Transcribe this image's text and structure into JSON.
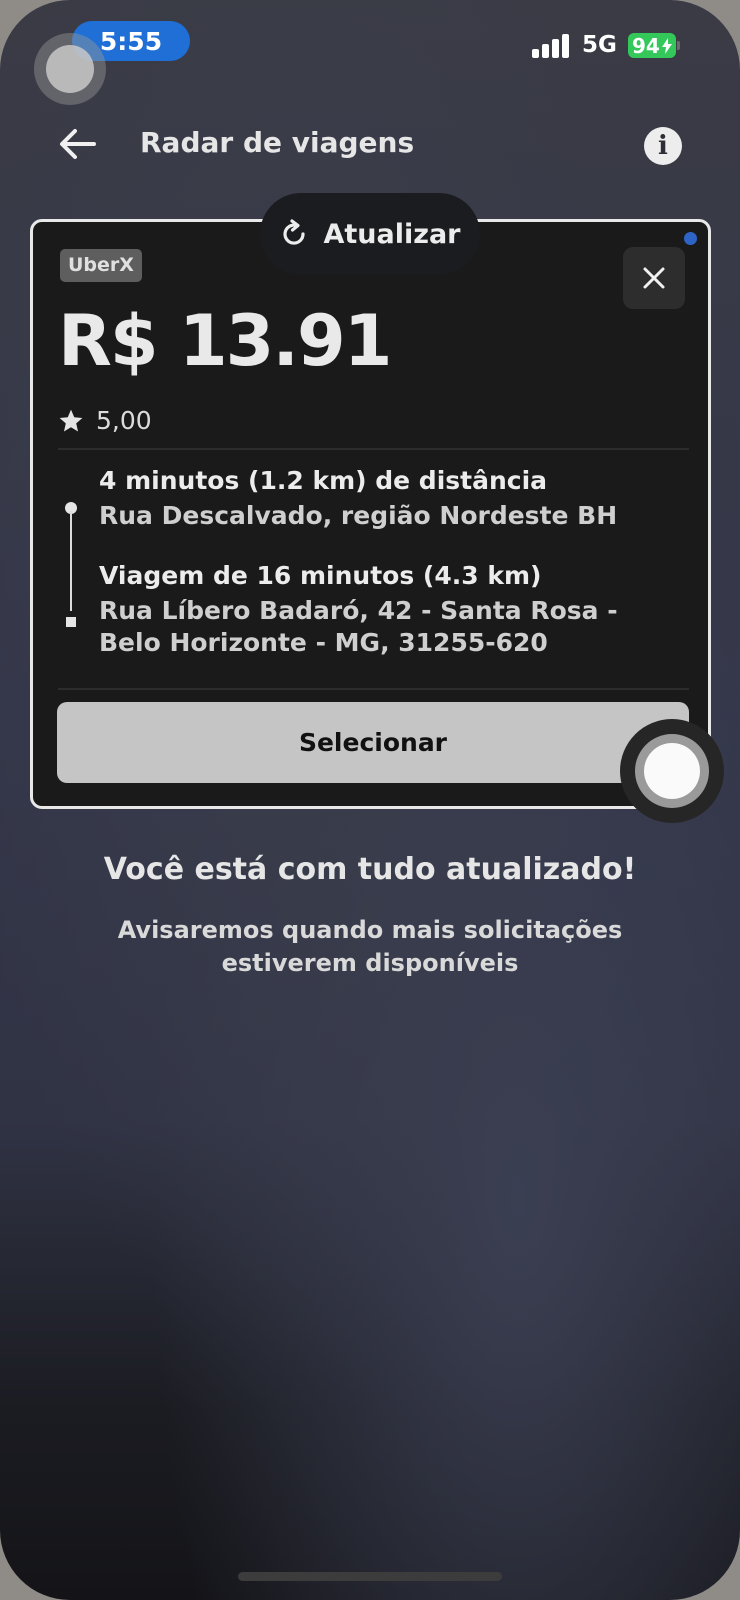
{
  "status_bar": {
    "time": "5:55",
    "network": "5G",
    "battery": "94"
  },
  "header": {
    "title": "Radar de viagens",
    "info_glyph": "i"
  },
  "refresh": {
    "label": "Atualizar"
  },
  "trip_card": {
    "category": "UberX",
    "price": "R$ 13.91",
    "rating": "5,00",
    "pickup": {
      "eta": "4 minutos (1.2 km) de distância",
      "address": "Rua Descalvado, região Nordeste BH"
    },
    "dropoff": {
      "eta": "Viagem de 16 minutos (4.3 km)",
      "address": "Rua Líbero Badaró, 42 - Santa Rosa - Belo Horizonte - MG, 31255-620"
    },
    "select_label": "Selecionar"
  },
  "empty_state": {
    "title": "Você está com tudo atualizado!",
    "subtitle": "Avisaremos quando mais solicitações estiverem disponíveis"
  },
  "colors": {
    "accent_blue": "#1f6fd6",
    "battery_green": "#34c759",
    "card_bg": "#1a1a1b"
  },
  "icons": [
    "back-arrow-icon",
    "info-icon",
    "refresh-icon",
    "close-icon",
    "star-icon"
  ]
}
